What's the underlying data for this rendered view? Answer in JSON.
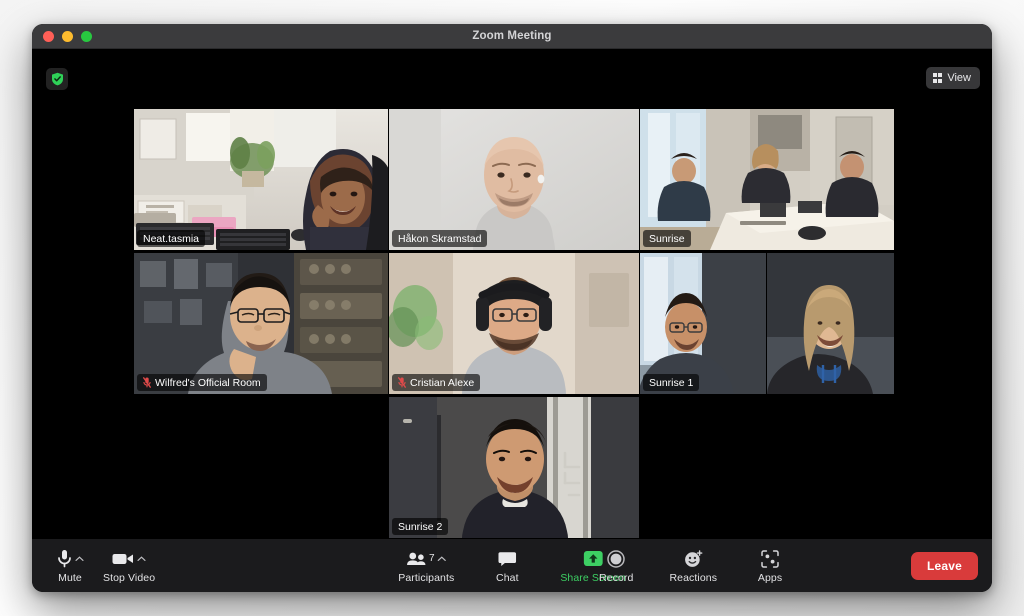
{
  "window": {
    "title": "Zoom Meeting",
    "traffic_lights": [
      "close",
      "minimize",
      "maximize"
    ]
  },
  "meeting": {
    "encryption_icon": "shield-check-icon",
    "view_button": {
      "label": "View",
      "icon": "grid-icon"
    },
    "participant_tiles": [
      {
        "name": "Neat.tasmia",
        "muted": false,
        "active_speaker": true,
        "row": 1,
        "col": 1
      },
      {
        "name": "Håkon Skramstad",
        "muted": false,
        "active_speaker": false,
        "row": 1,
        "col": 2
      },
      {
        "name": "Sunrise",
        "muted": false,
        "active_speaker": false,
        "row": 1,
        "col": 3
      },
      {
        "name": "Wilfred's Official Room",
        "muted": true,
        "active_speaker": false,
        "row": 2,
        "col": 1
      },
      {
        "name": "Cristian Alexe",
        "muted": true,
        "active_speaker": false,
        "row": 2,
        "col": 2
      },
      {
        "name": "Sunrise 1",
        "muted": false,
        "active_speaker": false,
        "row": 2,
        "col": 3
      },
      {
        "name": "",
        "muted": false,
        "active_speaker": false,
        "row": 2,
        "col": 4
      },
      {
        "name": "Sunrise 2",
        "muted": false,
        "active_speaker": false,
        "row": 3,
        "col": 2
      }
    ]
  },
  "toolbar": {
    "mute": {
      "label": "Mute",
      "icon": "microphone-icon",
      "has_chevron": true
    },
    "video": {
      "label": "Stop Video",
      "icon": "video-camera-icon",
      "has_chevron": true
    },
    "participants": {
      "label": "Participants",
      "icon": "people-icon",
      "count": "7",
      "has_chevron": true
    },
    "chat": {
      "label": "Chat",
      "icon": "speech-bubble-icon"
    },
    "share_screen": {
      "label": "Share Screen",
      "icon": "share-screen-up-arrow-icon"
    },
    "record": {
      "label": "Record",
      "icon": "record-circle-icon"
    },
    "reactions": {
      "label": "Reactions",
      "icon": "smiley-plus-icon"
    },
    "apps": {
      "label": "Apps",
      "icon": "apps-brackets-icon"
    },
    "leave": {
      "label": "Leave"
    }
  },
  "colors": {
    "active_speaker_border": "#d7e36a",
    "share_screen_accent": "#3dcf63",
    "leave_button": "#d93b3b",
    "titlebar": "#3b3b3d",
    "toolbar": "#1b1b1d",
    "meeting_background": "#000000"
  }
}
